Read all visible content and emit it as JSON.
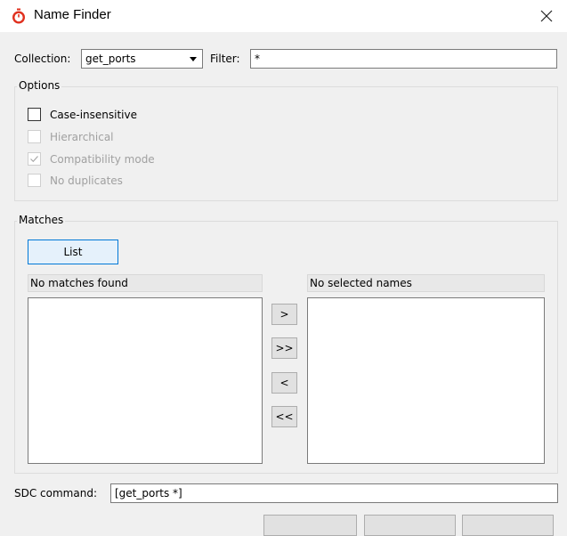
{
  "window": {
    "title": "Name Finder",
    "icon": "stopwatch-icon",
    "close_icon": "close-icon"
  },
  "collection": {
    "label": "Collection:",
    "value": "get_ports"
  },
  "filter": {
    "label": "Filter:",
    "value": "*"
  },
  "options": {
    "title": "Options",
    "items": [
      {
        "label": "Case-insensitive",
        "checked": false,
        "enabled": true
      },
      {
        "label": "Hierarchical",
        "checked": false,
        "enabled": false
      },
      {
        "label": "Compatibility mode",
        "checked": true,
        "enabled": false
      },
      {
        "label": "No duplicates",
        "checked": false,
        "enabled": false
      }
    ]
  },
  "matches": {
    "title": "Matches",
    "list_button": "List",
    "left_header": "No matches found",
    "right_header": "No selected names",
    "move_buttons": [
      ">",
      ">>",
      "<",
      "<<"
    ]
  },
  "sdc": {
    "label": "SDC command:",
    "value": "[get_ports *]"
  },
  "colors": {
    "accent": "#0078d7",
    "background": "#f0f0f0",
    "disabled_text": "#a0a0a0",
    "icon_red": "#e0301e"
  }
}
